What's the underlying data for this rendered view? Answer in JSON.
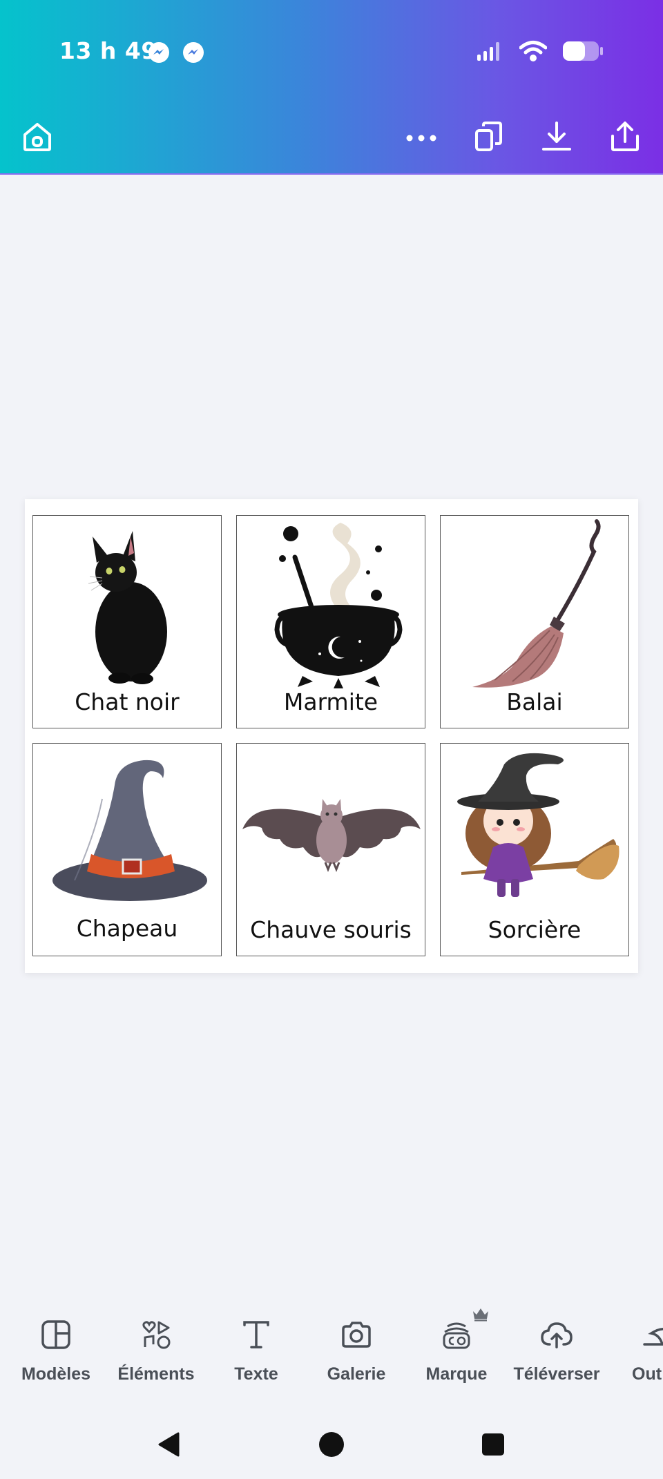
{
  "status_bar": {
    "time": "13 h 49",
    "notification_icons": [
      "messenger-icon",
      "messenger-icon"
    ],
    "right_icons": [
      "signal-icon",
      "wifi-icon",
      "battery-icon"
    ]
  },
  "toolbar": {
    "left_icon": "home-icon",
    "right_icons": [
      "more-icon",
      "duplicate-icon",
      "download-icon",
      "share-icon"
    ]
  },
  "cards": [
    {
      "label": "Chat noir",
      "icon": "black-cat-illustration"
    },
    {
      "label": "Marmite",
      "icon": "cauldron-illustration"
    },
    {
      "label": "Balai",
      "icon": "broom-illustration"
    },
    {
      "label": "Chapeau",
      "icon": "witch-hat-illustration"
    },
    {
      "label": "Chauve souris",
      "icon": "bat-illustration"
    },
    {
      "label": "Sorcière",
      "icon": "witch-illustration"
    }
  ],
  "bottom_tools": [
    {
      "label": "Modèles",
      "icon": "templates-icon"
    },
    {
      "label": "Éléments",
      "icon": "elements-icon"
    },
    {
      "label": "Texte",
      "icon": "text-icon"
    },
    {
      "label": "Galerie",
      "icon": "camera-icon"
    },
    {
      "label": "Marque",
      "icon": "brand-icon",
      "premium": true
    },
    {
      "label": "Téléverser",
      "icon": "upload-icon"
    },
    {
      "label": "Out",
      "icon": "tools-icon"
    }
  ],
  "navigation": [
    "back-icon",
    "home-circle-icon",
    "recents-icon"
  ],
  "colors": {
    "gradient_start": "#05c3cc",
    "gradient_end": "#7b2fe5",
    "background": "#f2f3f8",
    "tool_label": "#4a4f57"
  }
}
